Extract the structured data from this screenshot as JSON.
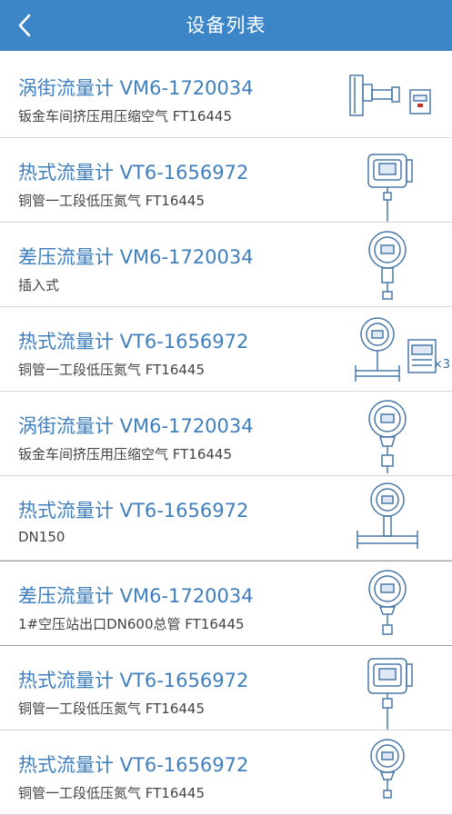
{
  "header": {
    "title": "设备列表"
  },
  "devices": [
    {
      "title": "涡街流量计  VM6-1720034",
      "subtitle": "钣金车间挤压用压缩空气 FT16445",
      "icon": "vortex-meter-icon"
    },
    {
      "title": "热式流量计  VT6-1656972",
      "subtitle": "铜管一工段低压氮气 FT16445",
      "icon": "thermal-meter-icon"
    },
    {
      "title": "差压流量计  VM6-1720034",
      "subtitle": "插入式",
      "icon": "dp-meter-icon"
    },
    {
      "title": "热式流量计  VT6-1656972",
      "subtitle": "铜管一工段低压氮气 FT16445",
      "icon": "thermal-pipe-meter-icon",
      "extra": "×3"
    },
    {
      "title": "涡街流量计  VM6-1720034",
      "subtitle": "钣金车间挤压用压缩空气 FT16445",
      "icon": "vortex-probe-icon"
    },
    {
      "title": "热式流量计  VT6-1656972",
      "subtitle": "DN150",
      "icon": "thermal-flange-meter-icon"
    },
    {
      "title": "差压流量计  VM6-1720034",
      "subtitle": "1#空压站出口DN600总管 FT16445",
      "icon": "dp-probe-icon"
    },
    {
      "title": "热式流量计  VT6-1656972",
      "subtitle": "铜管一工段低压氮气 FT16445",
      "icon": "thermal-meter-icon"
    },
    {
      "title": "热式流量计  VT6-1656972",
      "subtitle": "铜管一工段低压氮气 FT16445",
      "icon": "thermal-probe-icon"
    }
  ],
  "colors": {
    "header": "#3c86c8",
    "title_text": "#3f7fbd",
    "icon_line": "#4a78a8"
  }
}
